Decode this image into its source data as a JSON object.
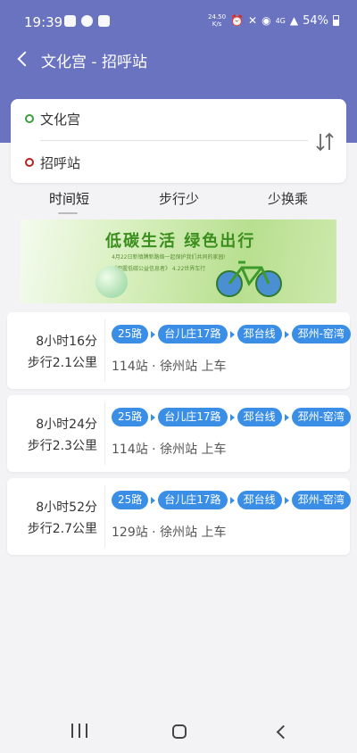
{
  "status_bar": {
    "time": "19:39",
    "net_speed_value": "24.50",
    "net_speed_unit": "K/s",
    "network": "4G",
    "battery": "54%",
    "left_icons": [
      "photo-icon",
      "app-notification-icon",
      "check-notification-icon"
    ],
    "right_icons": [
      "alarm-icon",
      "mute-icon",
      "wifi-icon",
      "signal-icon",
      "battery-icon"
    ]
  },
  "header": {
    "title": "文化宫 - 招呼站",
    "color": "#6a73c0"
  },
  "route": {
    "from": "文化宫",
    "to": "招呼站",
    "from_color": "#39a03b",
    "to_color": "#b32323"
  },
  "tabs": [
    {
      "label": "时间短",
      "selected": true
    },
    {
      "label": "步行少",
      "selected": false
    },
    {
      "label": "少换乘",
      "selected": false
    }
  ],
  "banner": {
    "headline": "低碳生活  绿色出行",
    "line1": "4月22日新镇膊新路络一起保护我们共同的家园!",
    "line2": "《把握低碳公益信息者》 4.22世界车行"
  },
  "results": [
    {
      "duration": "8小时16分",
      "walk": "步行2.1公里",
      "lines": [
        "25路",
        "台儿庄17路",
        "邳台线",
        "邳州-窑湾"
      ],
      "info": "114站 · 徐州站 上车"
    },
    {
      "duration": "8小时24分",
      "walk": "步行2.3公里",
      "lines": [
        "25路",
        "台儿庄17路",
        "邳台线",
        "邳州-窑湾"
      ],
      "info": "114站 · 徐州站 上车"
    },
    {
      "duration": "8小时52分",
      "walk": "步行2.7公里",
      "lines": [
        "25路",
        "台儿庄17路",
        "邳台线",
        "邳州-窑湾"
      ],
      "info": "129站 · 徐州站 上车"
    }
  ],
  "colors": {
    "chip": "#3a8ee6",
    "background": "#f3f3f5"
  },
  "nav_bar": {
    "icons": [
      "recent-apps-icon",
      "home-icon",
      "back-icon"
    ]
  }
}
